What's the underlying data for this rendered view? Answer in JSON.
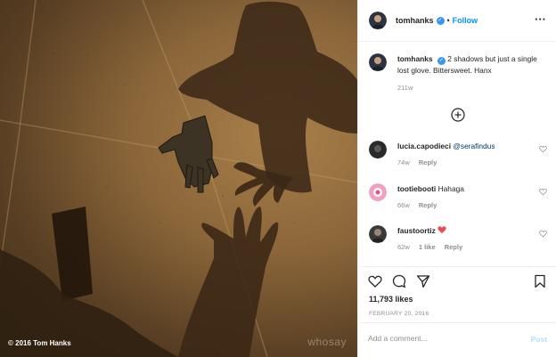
{
  "photo": {
    "credit": "© 2016 Tom Hanks",
    "watermark": "whosay"
  },
  "header": {
    "username": "tomhanks",
    "verified_icon": "verified-badge-icon",
    "separator": "•",
    "follow_label": "Follow",
    "more_icon": "more-options-icon",
    "more_glyph": "···"
  },
  "caption": {
    "username": "tomhanks",
    "text": "2 shadows but just a single lost glove. Bittersweet. Hanx",
    "time": "211w"
  },
  "load_more_icon": "plus-circle-icon",
  "comments": [
    {
      "username": "lucia.capodieci",
      "text": "@serafindus",
      "time": "74w",
      "reply": "Reply",
      "likes": ""
    },
    {
      "username": "tootiebooti",
      "text": "Hahaga",
      "time": "66w",
      "reply": "Reply",
      "likes": ""
    },
    {
      "username": "faustoortiz",
      "text": "",
      "emoji": "heart-emoji",
      "time": "62w",
      "likes": "1 like",
      "reply": "Reply"
    }
  ],
  "actions": {
    "like_icon": "heart-icon",
    "comment_icon": "comment-icon",
    "share_icon": "send-icon",
    "save_icon": "bookmark-icon"
  },
  "likes": "11,793 likes",
  "date": "FEBRUARY 20, 2016",
  "add_comment": {
    "placeholder": "Add a comment...",
    "post_label": "Post"
  },
  "colors": {
    "accent": "#0095f6",
    "verified": "#3897f0",
    "post_disabled": "#b2dffc",
    "muted": "#8e8e8e",
    "heart_red": "#ed4956"
  }
}
